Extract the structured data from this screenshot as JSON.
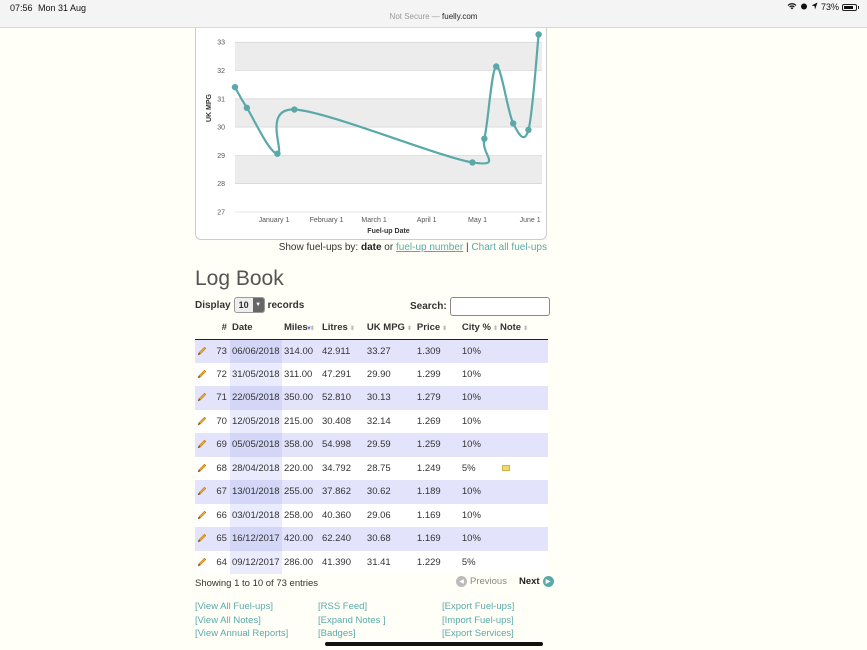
{
  "status_bar": {
    "time": "07:56",
    "date": "Mon 31 Aug",
    "battery": "73%",
    "url_prefix": "Not Secure — ",
    "url_domain": "fuelly.com"
  },
  "chart_data": {
    "type": "line",
    "xlabel": "Fuel-up Date",
    "ylabel": "UK MPG",
    "ylim": [
      27,
      33.5
    ],
    "yticks": [
      27,
      28,
      29,
      30,
      31,
      32,
      33
    ],
    "xticks": [
      {
        "label": "January 1",
        "date": "2018-01-01"
      },
      {
        "label": "February 1",
        "date": "2018-02-01"
      },
      {
        "label": "March 1",
        "date": "2018-03-01"
      },
      {
        "label": "April 1",
        "date": "2018-04-01"
      },
      {
        "label": "May 1",
        "date": "2018-05-01"
      },
      {
        "label": "June 1",
        "date": "2018-06-01"
      }
    ],
    "xlim": [
      "2017-12-09",
      "2018-06-08"
    ],
    "color": "#5aa9a8",
    "series": [
      {
        "x": [
          "2017-12-09",
          "2017-12-16",
          "2018-01-03",
          "2018-01-13",
          "2018-04-28",
          "2018-05-05",
          "2018-05-12",
          "2018-05-22",
          "2018-05-31",
          "2018-06-06"
        ],
        "y": [
          31.41,
          30.68,
          29.06,
          30.62,
          28.75,
          29.59,
          32.14,
          30.13,
          29.9,
          33.27
        ]
      }
    ]
  },
  "show_by": {
    "prefix": "Show fuel-ups by: ",
    "date": "date",
    "or": " or ",
    "number_link": "fuel-up number",
    "sep": " | ",
    "chart_all": "Chart all fuel-ups"
  },
  "logbook": {
    "title": "Log Book",
    "display_label": "Display",
    "display_value": "10",
    "records_label": "records",
    "search_label": "Search:",
    "columns": [
      "#",
      "Date",
      "Miles",
      "Litres",
      "UK MPG",
      "Price",
      "City %",
      "Note"
    ],
    "rows": [
      {
        "num": "73",
        "date": "06/06/2018",
        "miles": "314.00",
        "litres": "42.911",
        "mpg": "33.27",
        "price": "1.309",
        "city": "10%",
        "note": ""
      },
      {
        "num": "72",
        "date": "31/05/2018",
        "miles": "311.00",
        "litres": "47.291",
        "mpg": "29.90",
        "price": "1.299",
        "city": "10%",
        "note": ""
      },
      {
        "num": "71",
        "date": "22/05/2018",
        "miles": "350.00",
        "litres": "52.810",
        "mpg": "30.13",
        "price": "1.279",
        "city": "10%",
        "note": ""
      },
      {
        "num": "70",
        "date": "12/05/2018",
        "miles": "215.00",
        "litres": "30.408",
        "mpg": "32.14",
        "price": "1.269",
        "city": "10%",
        "note": ""
      },
      {
        "num": "69",
        "date": "05/05/2018",
        "miles": "358.00",
        "litres": "54.998",
        "mpg": "29.59",
        "price": "1.259",
        "city": "10%",
        "note": ""
      },
      {
        "num": "68",
        "date": "28/04/2018",
        "miles": "220.00",
        "litres": "34.792",
        "mpg": "28.75",
        "price": "1.249",
        "city": "5%",
        "note": "note-icon"
      },
      {
        "num": "67",
        "date": "13/01/2018",
        "miles": "255.00",
        "litres": "37.862",
        "mpg": "30.62",
        "price": "1.189",
        "city": "10%",
        "note": ""
      },
      {
        "num": "66",
        "date": "03/01/2018",
        "miles": "258.00",
        "litres": "40.360",
        "mpg": "29.06",
        "price": "1.169",
        "city": "10%",
        "note": ""
      },
      {
        "num": "65",
        "date": "16/12/2017",
        "miles": "420.00",
        "litres": "62.240",
        "mpg": "30.68",
        "price": "1.169",
        "city": "10%",
        "note": ""
      },
      {
        "num": "64",
        "date": "09/12/2017",
        "miles": "286.00",
        "litres": "41.390",
        "mpg": "31.41",
        "price": "1.229",
        "city": "5%",
        "note": ""
      }
    ],
    "info": "Showing 1 to 10 of 73 entries",
    "prev": "Previous",
    "next": "Next"
  },
  "footer_links": {
    "col1": [
      "[View All Fuel-ups]",
      "[View All Notes]",
      "[View Annual Reports]"
    ],
    "col2": [
      "[RSS Feed]",
      "[Expand Notes ]",
      "[Badges]"
    ],
    "col3": [
      "[Export Fuel-ups]",
      "[Import Fuel-ups]",
      "[Export Services]"
    ]
  }
}
